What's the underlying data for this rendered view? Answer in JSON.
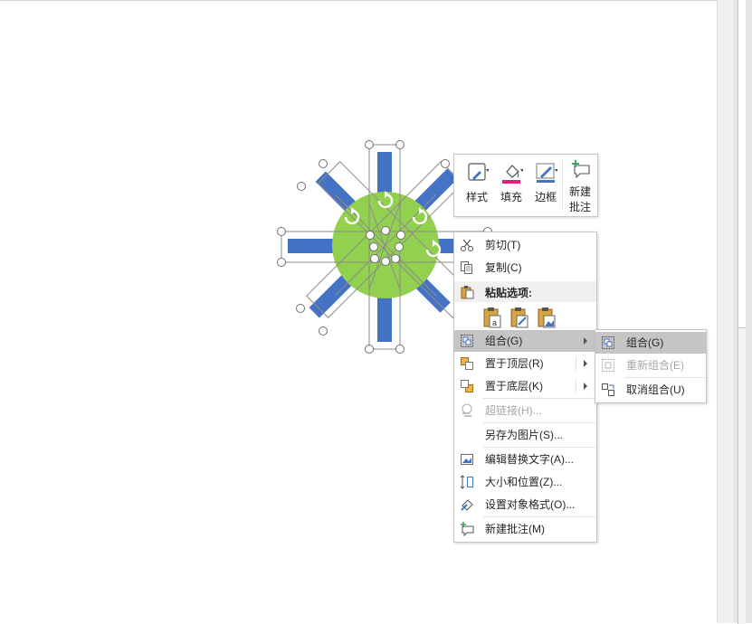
{
  "mini_toolbar": {
    "style_label": "样式",
    "fill_label": "填充",
    "border_label": "边框",
    "new_comment_line1": "新建",
    "new_comment_line2": "批注",
    "fill_color": "#e0207a",
    "accent_color": "#4472c4"
  },
  "context_menu": {
    "cut": "剪切(T)",
    "copy": "复制(C)",
    "paste_options": "粘贴选项:",
    "group": "组合(G)",
    "bring_to_front": "置于顶层(R)",
    "send_to_back": "置于底层(K)",
    "hyperlink": "超链接(H)...",
    "save_as_picture": "另存为图片(S)...",
    "edit_alt_text": "编辑替换文字(A)...",
    "size_position": "大小和位置(Z)...",
    "format_object": "设置对象格式(O)...",
    "new_comment": "新建批注(M)"
  },
  "submenu": {
    "group": "组合(G)",
    "regroup": "重新组合(E)",
    "ungroup": "取消组合(U)"
  },
  "shape": {
    "circle_color": "#92d050",
    "bar_color": "#4472c4"
  }
}
